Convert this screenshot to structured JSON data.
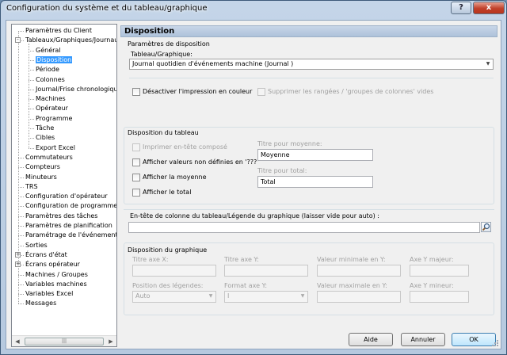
{
  "window": {
    "title": "Configuration du système et du tableau/graphique",
    "help_glyph": "?",
    "close_glyph": "x"
  },
  "tree": {
    "items": [
      {
        "label": "Paramètres du Client"
      },
      {
        "label": "Tableaux/Graphiques/Journaux",
        "expander": "-"
      },
      {
        "label": "Général"
      },
      {
        "label": "Disposition",
        "selected": true
      },
      {
        "label": "Période"
      },
      {
        "label": "Colonnes"
      },
      {
        "label": "Journal/Frise chronologique"
      },
      {
        "label": "Machines"
      },
      {
        "label": "Opérateur"
      },
      {
        "label": "Programme"
      },
      {
        "label": "Tâche"
      },
      {
        "label": "Cibles"
      },
      {
        "label": "Export Excel"
      },
      {
        "label": "Commutateurs"
      },
      {
        "label": "Compteurs"
      },
      {
        "label": "Minuteurs"
      },
      {
        "label": "TRS"
      },
      {
        "label": "Configuration d'opérateur"
      },
      {
        "label": "Configuration de programme"
      },
      {
        "label": "Paramètres des tâches"
      },
      {
        "label": "Paramètres de planification"
      },
      {
        "label": "Paramétrage de l'événement"
      },
      {
        "label": "Sorties"
      },
      {
        "label": "Écrans d'état",
        "expander": "+"
      },
      {
        "label": "Écrans opérateur",
        "expander": "+"
      },
      {
        "label": "Machines / Groupes"
      },
      {
        "label": "Variables machines"
      },
      {
        "label": "Variables Excel"
      },
      {
        "label": "Messages"
      }
    ],
    "scroll_thumb_glyph": "|||",
    "scroll_left_glyph": "◀",
    "scroll_right_glyph": "▶"
  },
  "panel": {
    "heading": "Disposition",
    "layout_group": {
      "title": "Paramètres de disposition",
      "chart_label": "Tableau/Graphique:",
      "chart_value": "Journal quotidien d'événements machine  (Journal )",
      "disable_color_print": "Désactiver l'impression en couleur",
      "suppress_empty_rows": "Supprimer les rangées / 'groupes de colonnes' vides"
    },
    "table_group": {
      "title": "Disposition du tableau",
      "print_header": "Imprimer en-tête composé",
      "show_undefined": "Afficher valeurs non définies en '???'",
      "show_average": "Afficher la moyenne",
      "show_total": "Afficher le total",
      "avg_title_label": "Titre pour moyenne:",
      "avg_title_value": "Moyenne",
      "total_title_label": "Titre pour total:",
      "total_title_value": "Total"
    },
    "column_header": {
      "label": "En-tête de colonne du tableau/Légende du graphique (laisser vide pour auto) :",
      "value": ""
    },
    "chart_group": {
      "title": "Disposition du graphique",
      "x_axis_title": "Titre axe X:",
      "y_axis_title": "Titre axe Y:",
      "min_y": "Valeur minimale en Y:",
      "y_major": "Axe Y majeur:",
      "legend_position_label": "Position des légendes:",
      "legend_position_value": "Auto",
      "y_format_label": "Format axe Y:",
      "y_format_value": "I",
      "max_y": "Valeur maximale en Y:",
      "y_minor": "Axe Y mineur:"
    }
  },
  "buttons": {
    "help": "Aide",
    "cancel": "Annuler",
    "ok": "OK"
  }
}
